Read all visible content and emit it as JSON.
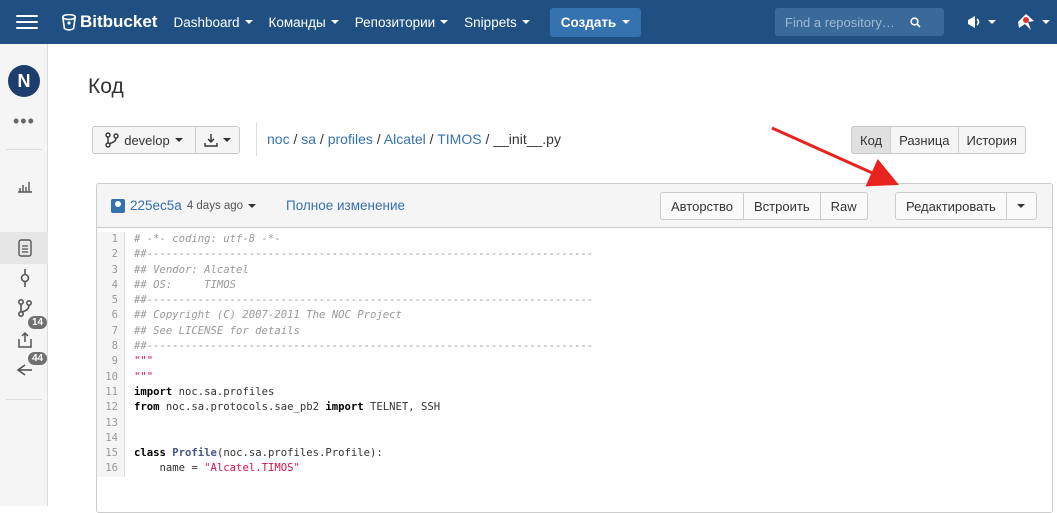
{
  "topbar": {
    "brand": "Bitbucket",
    "nav": [
      {
        "label": "Dashboard"
      },
      {
        "label": "Команды"
      },
      {
        "label": "Репозитории"
      },
      {
        "label": "Snippets"
      }
    ],
    "create_label": "Создать",
    "search_placeholder": "Find a repository…",
    "bg_color": "#205081"
  },
  "sidebar": {
    "avatar_letter": "N",
    "more_label": "•••",
    "pull_requests_count": "14",
    "forks_count": "44"
  },
  "page": {
    "title": "Код",
    "branch": "develop",
    "breadcrumb": {
      "parts": [
        "noc",
        "sa",
        "profiles",
        "Alcatel",
        "TIMOS"
      ],
      "sep": " / ",
      "file": "__init__.py"
    },
    "view_tabs": [
      "Код",
      "Разница",
      "История"
    ]
  },
  "file_header": {
    "commit_hash": "225ec5a",
    "commit_time": "4 days ago",
    "full_change_label": "Полное изменение",
    "actions": [
      "Авторство",
      "Встроить",
      "Raw"
    ],
    "edit_label": "Редактировать"
  },
  "code_lines": [
    {
      "n": "1",
      "text": "# -*- coding: utf-8 -*-"
    },
    {
      "n": "2",
      "text": "##----------------------------------------------------------------------"
    },
    {
      "n": "3",
      "text": "## Vendor: Alcatel"
    },
    {
      "n": "4",
      "text": "## OS:     TIMOS"
    },
    {
      "n": "5",
      "text": "##----------------------------------------------------------------------"
    },
    {
      "n": "6",
      "text": "## Copyright (C) 2007-2011 The NOC Project"
    },
    {
      "n": "7",
      "text": "## See LICENSE for details"
    },
    {
      "n": "8",
      "text": "##----------------------------------------------------------------------"
    },
    {
      "n": "9",
      "text": "\"\"\""
    },
    {
      "n": "10",
      "text": "\"\"\""
    },
    {
      "n": "11",
      "text": "import noc.sa.profiles"
    },
    {
      "n": "12",
      "text": "from noc.sa.protocols.sae_pb2 import TELNET, SSH"
    },
    {
      "n": "13",
      "text": ""
    },
    {
      "n": "14",
      "text": ""
    },
    {
      "n": "15",
      "text": "class Profile(noc.sa.profiles.Profile):"
    },
    {
      "n": "16",
      "text": "    name = \"Alcatel.TIMOS\""
    }
  ],
  "annotation": {
    "arrow_color": "#e8231d"
  }
}
